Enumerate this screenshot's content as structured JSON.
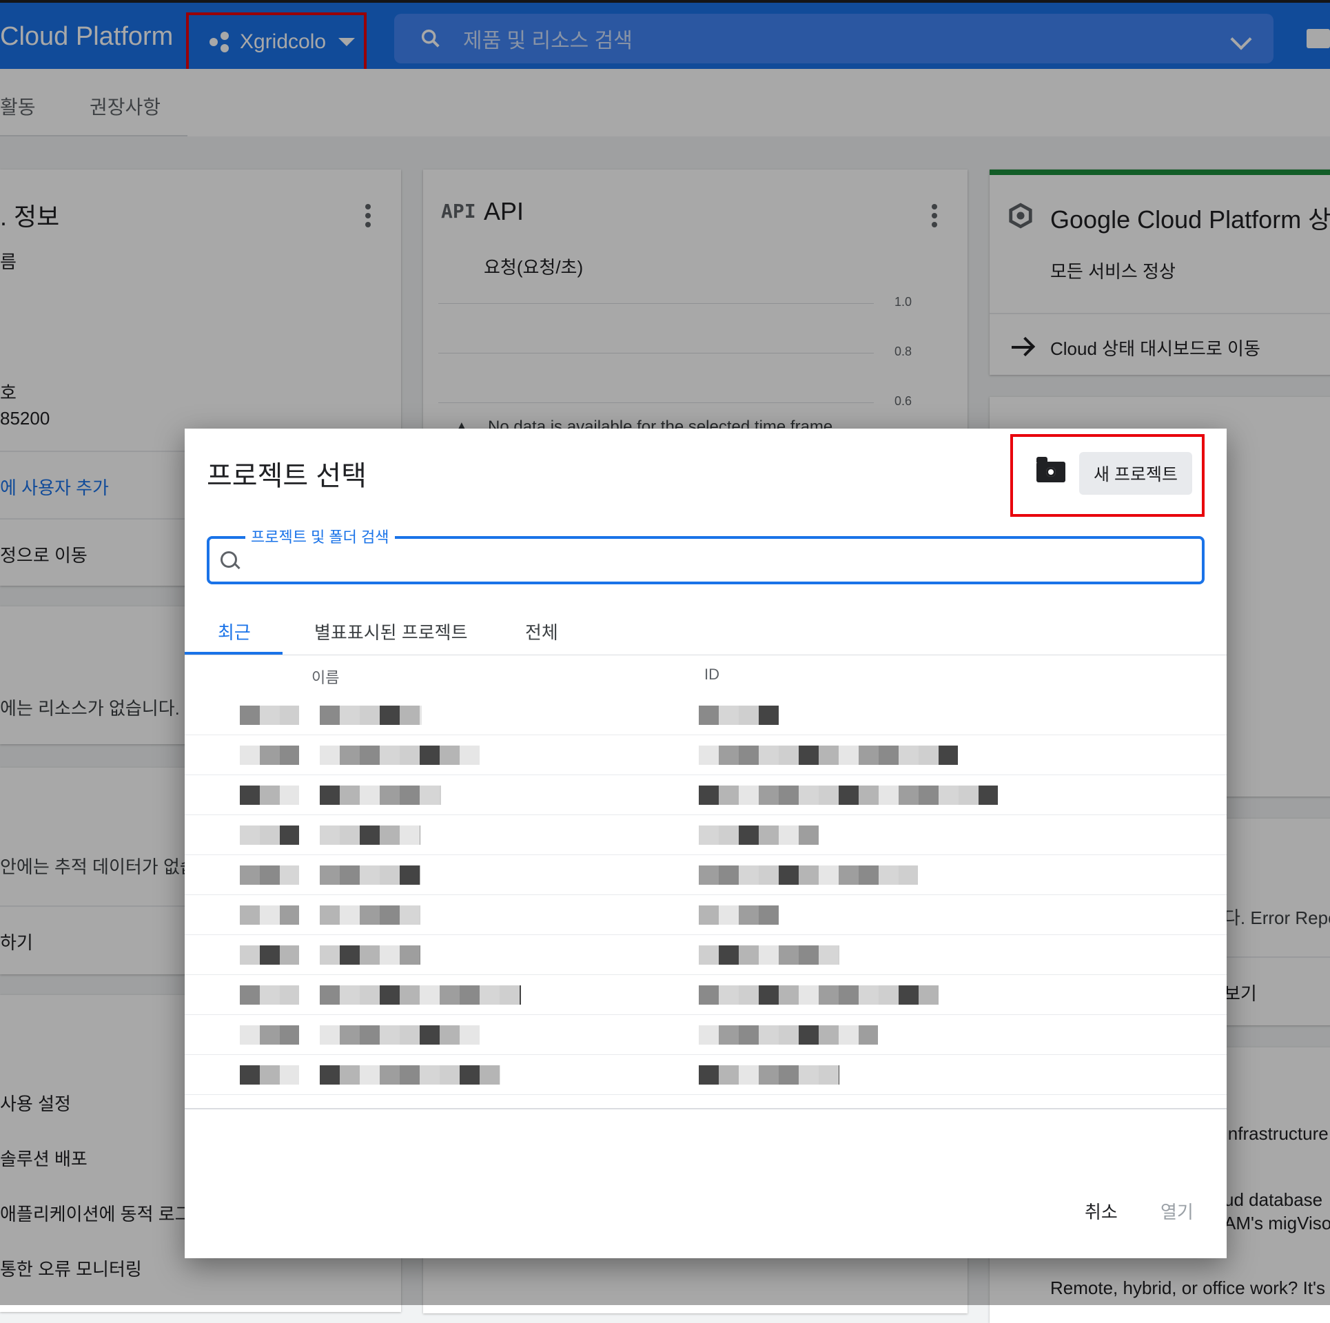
{
  "topbar": {
    "brand": "Cloud Platform",
    "project_name": "Xgridcolo",
    "search_placeholder": "제품 및 리소스 검색"
  },
  "subnav": {
    "tabs": [
      "활동",
      "권장사항"
    ]
  },
  "card_info": {
    "title": ". 정보",
    "label_name": "름",
    "label_number": "호",
    "number_value": "85200",
    "link_add_user": "에 사용자 추가",
    "link_settings": "정으로 이동"
  },
  "card_resources": {
    "text": "에는 리소스가 없습니다."
  },
  "card_trace": {
    "text": "안에는 추적 데이터가 없습",
    "link": "하기"
  },
  "card_getting_started": {
    "items": [
      "사용 설정",
      "솔루션 배포",
      "애플리케이션에 동적 로그 기",
      "통한 오류 모니터링"
    ]
  },
  "card_api": {
    "icon_label": "API",
    "title": "API",
    "subtitle": "요청(요청/초)",
    "ticks": [
      "1.0",
      "0.8",
      "0.6"
    ],
    "no_data": "No data is available for the selected time frame."
  },
  "card_status": {
    "title": "Google Cloud Platform 상",
    "status": "모든 서비스 정상",
    "link": "Cloud 상태 대시보드로 이동"
  },
  "card_right_partial": {
    "error_text": "다. Error Repo",
    "link": "보기",
    "news": [
      "infrastructure",
      "ud database",
      "AM's migViso",
      "Remote, hybrid, or office work? It's e"
    ]
  },
  "dialog": {
    "title": "프로젝트 선택",
    "new_project": "새 프로젝트",
    "search_label": "프로젝트 및 폴더 검색",
    "tabs": [
      "최근",
      "별표표시된 프로젝트",
      "전체"
    ],
    "col_name": "이름",
    "col_id": "ID",
    "cancel": "취소",
    "open": "열기"
  },
  "colors": {
    "primary": "#1a73e8",
    "highlight": "#e8000b",
    "status_bar": "#1e8e3e"
  }
}
